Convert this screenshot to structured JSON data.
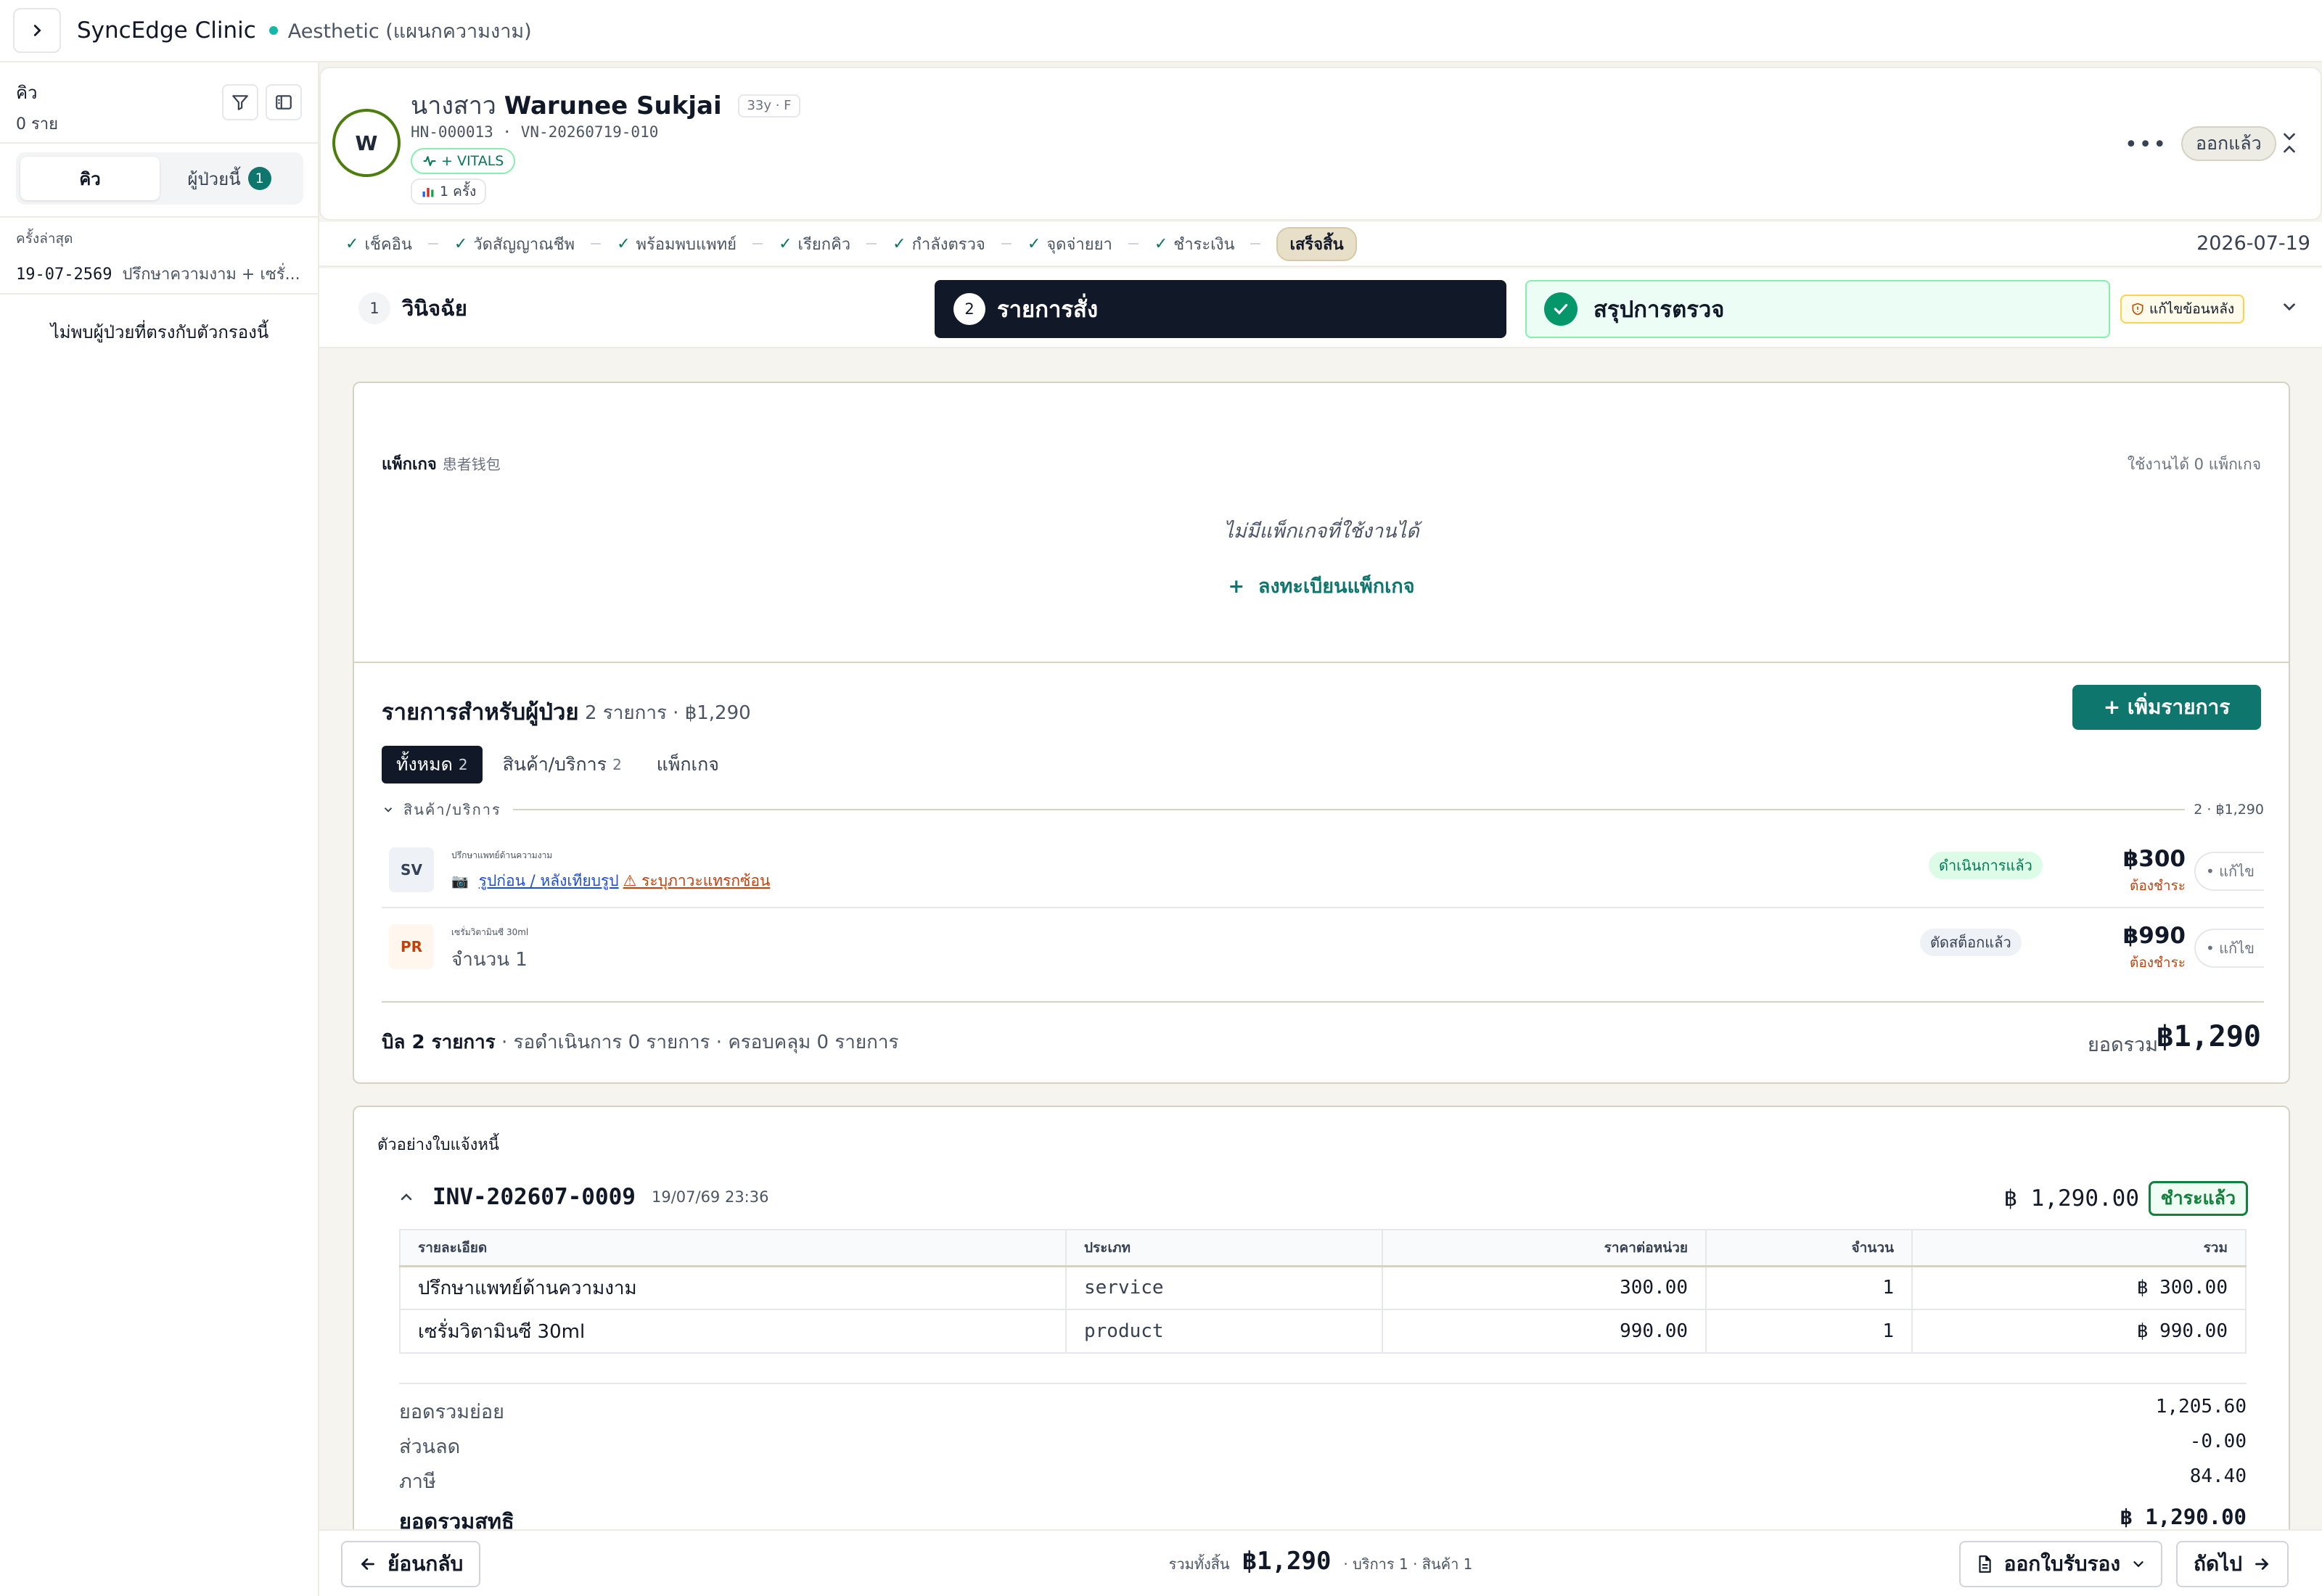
{
  "topbar": {
    "clinic": "SyncEdge Clinic",
    "department": "Aesthetic (แผนกความงาม)"
  },
  "sidebar": {
    "title": "คิว",
    "count": "0 ราย",
    "tabs": [
      {
        "label": "คิว"
      },
      {
        "label": "ผู้ป่วยนี้",
        "badge": "1"
      }
    ],
    "last_label": "ครั้งล่าสุด",
    "last_date": "19-07-2569",
    "last_text": "ปรึกษาความงาม + เซรั่...",
    "empty": "ไม่พบผู้ป่วยที่ตรงกับตัวกรองนี้"
  },
  "patient": {
    "initial": "W",
    "prefix": "นางสาว",
    "name": "Warunee Sukjai",
    "meta": "33y · F",
    "ids": "HN-000013 · VN-20260719-010",
    "vitals": "+ VITALS",
    "visits": "1 ครั้ง",
    "status": "ออกแล้ว"
  },
  "progress": {
    "steps": [
      "เช็คอิน",
      "วัดสัญญาณชีพ",
      "พร้อมพบแพทย์",
      "เรียกคิว",
      "กำลังตรวจ",
      "จุดจ่ายยา",
      "ชำระเงิน"
    ],
    "final": "เสร็จสิ้น",
    "date": "2026-07-19"
  },
  "wizard": {
    "step1_num": "1",
    "step1": "วินิจฉัย",
    "step2_num": "2",
    "step2": "รายการสั่ง",
    "step3": "สรุปการตรวจ",
    "edit_after": "แก้ไขข้อนหลัง"
  },
  "packages": {
    "title": "แพ็กเกจ",
    "subtitle": "患者钱包",
    "available": "ใช้งานได้ 0 แพ็กเกจ",
    "empty": "ไม่มีแพ็กเกจที่ใช้งานได้",
    "register": "ลงทะเบียนแพ็กเกจ"
  },
  "items": {
    "title": "รายการสำหรับผู้ป่วย",
    "summary": "2 รายการ · ฿1,290",
    "add": "+ เพิ่มรายการ",
    "tabs": [
      {
        "label": "ทั้งหมด",
        "count": "2"
      },
      {
        "label": "สินค้า/บริการ",
        "count": "2"
      },
      {
        "label": "แพ็กเกจ",
        "count": ""
      }
    ],
    "group_label": "สินค้า/บริการ",
    "group_sum": "2 · ฿1,290",
    "rows": [
      {
        "badge": "SV",
        "name": "ปรึกษาแพทย์ด้านความงาม",
        "link1": "รูปก่อน / หลังเทียบรูป",
        "link2": "ระบุภาวะแทรกซ้อน",
        "status": "ดำเนินการแล้ว",
        "price": "฿300",
        "due": "ต้องชำระ",
        "edit": "แก้ไข"
      },
      {
        "badge": "PR",
        "name": "เซรั่มวิตามินซี 30ml",
        "qty": "จำนวน 1",
        "status": "ตัดสต็อกแล้ว",
        "price": "฿990",
        "due": "ต้องชำระ",
        "edit": "แก้ไข"
      }
    ],
    "bill_bold": "บิล 2 รายการ",
    "bill_rest": "· รอดำเนินการ 0 รายการ · ครอบคลุม 0 รายการ",
    "total_label": "ยอดรวม",
    "total": "฿1,290"
  },
  "invoice": {
    "preview": "ตัวอย่างใบแจ้งหนี้",
    "number": "INV-202607-0009",
    "date": "19/07/69 23:36",
    "amount": "฿ 1,290.00",
    "status": "ชำระแล้ว",
    "headers": [
      "รายละเอียด",
      "ประเภท",
      "ราคาต่อหน่วย",
      "จำนวน",
      "รวม"
    ],
    "rows": [
      {
        "desc": "ปรึกษาแพทย์ด้านความงาม",
        "type": "service",
        "unit": "300.00",
        "qty": "1",
        "total": "฿ 300.00"
      },
      {
        "desc": "เซรั่มวิตามินซี 30ml",
        "type": "product",
        "unit": "990.00",
        "qty": "1",
        "total": "฿ 990.00"
      }
    ],
    "subtotal_label": "ยอดรวมย่อย",
    "subtotal": "1,205.60",
    "discount_label": "ส่วนลด",
    "discount": "-0.00",
    "tax_label": "ภาษี",
    "tax": "84.40",
    "net_label": "ยอดรวมสุทธิ",
    "net": "฿ 1,290.00"
  },
  "bottom": {
    "back": "ย้อนกลับ",
    "total_label": "รวมทั้งสิ้น",
    "total": "฿1,290",
    "detail": "· บริการ 1 · สินค้า 1",
    "certificate": "ออกใบรับรอง",
    "next": "ถัดไป"
  }
}
